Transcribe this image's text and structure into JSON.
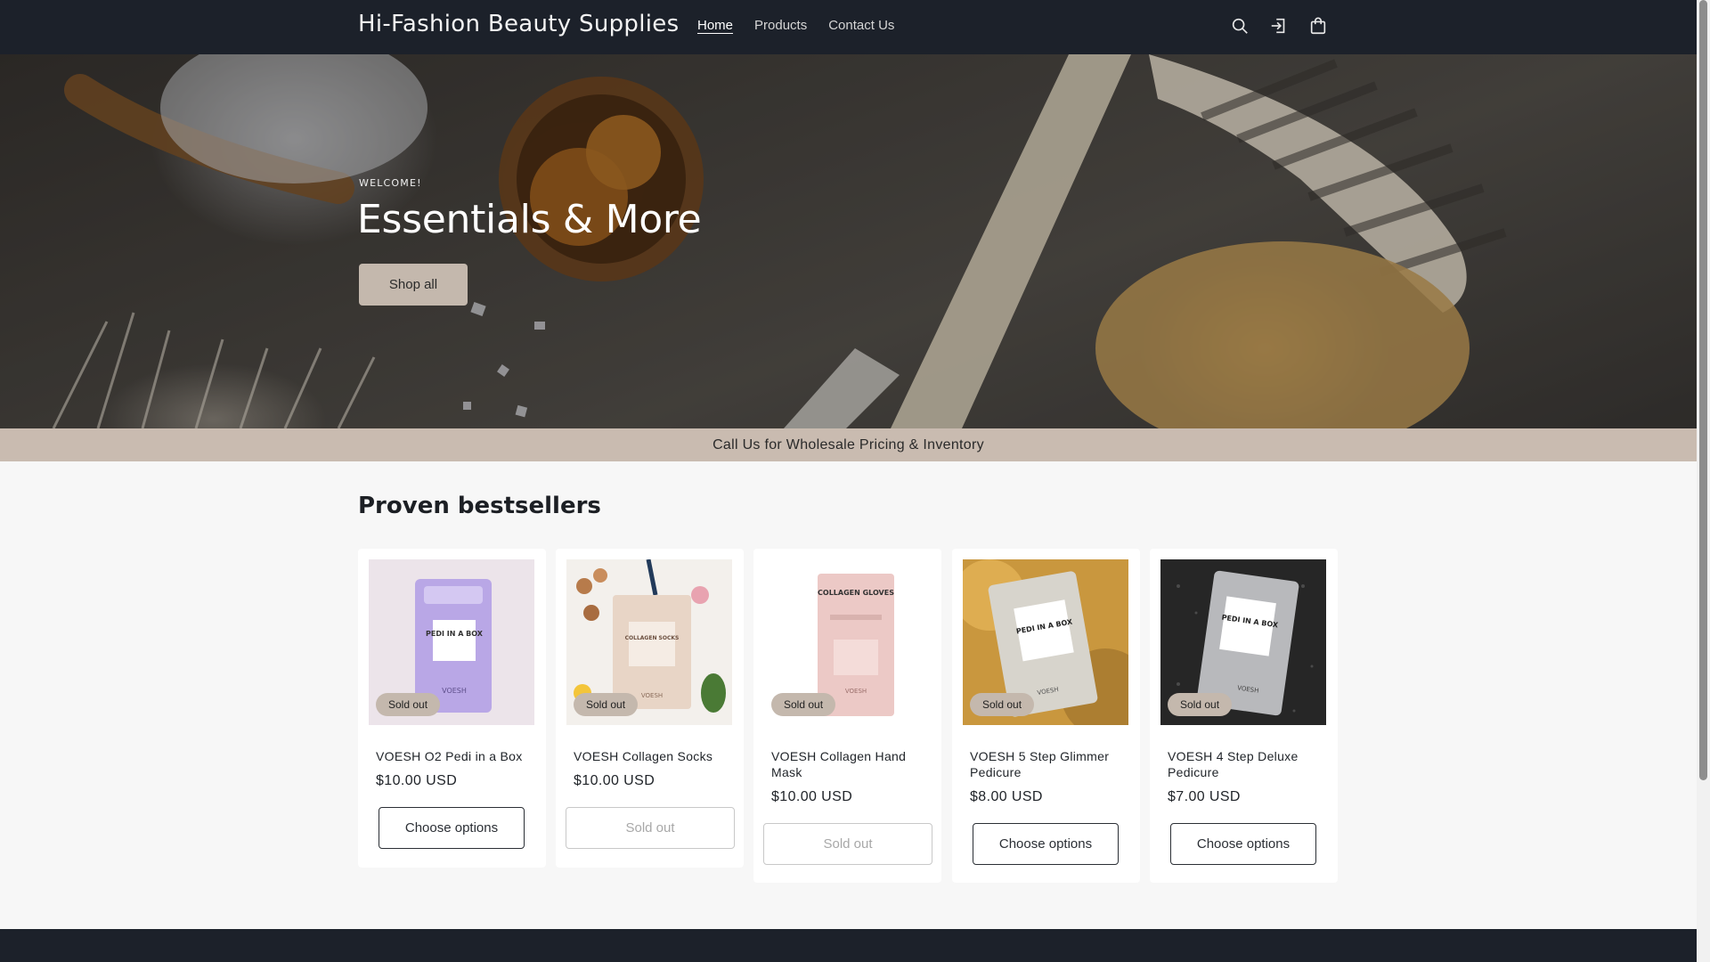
{
  "header": {
    "brand": "Hi-Fashion Beauty Supplies",
    "nav": [
      "Home",
      "Products",
      "Contact Us"
    ],
    "active_nav": "Home",
    "icons": [
      "search-icon",
      "account-icon",
      "cart-icon"
    ],
    "background": "#1c212a"
  },
  "hero": {
    "eyebrow": "WELCOME!",
    "title": "Essentials & More",
    "button": "Shop all"
  },
  "announcement": {
    "text": "Call Us for Wholesale Pricing & Inventory",
    "background": "#c9bbb0"
  },
  "bestsellers": {
    "title": "Proven bestsellers",
    "products": [
      {
        "name": "VOESH O2 Pedi in a Box",
        "price": "$10.00 USD",
        "badge": "Sold out",
        "button": "Choose options",
        "button_disabled": false,
        "package_text": "PEDI IN A BOX",
        "brand_text": "VOESH"
      },
      {
        "name": "VOESH Collagen Socks",
        "price": "$10.00 USD",
        "badge": "Sold out",
        "button": "Sold out",
        "button_disabled": true,
        "package_text": "COLLAGEN SOCKS",
        "brand_text": "VOESH"
      },
      {
        "name": "VOESH Collagen Hand Mask",
        "price": "$10.00 USD",
        "badge": "Sold out",
        "button": "Sold out",
        "button_disabled": true,
        "package_text": "COLLAGEN GLOVES",
        "brand_text": "VOESH"
      },
      {
        "name": "VOESH 5 Step Glimmer Pedicure",
        "price": "$8.00 USD",
        "badge": "Sold out",
        "button": "Choose options",
        "button_disabled": false,
        "package_text": "PEDI IN A BOX",
        "brand_text": "VOESH"
      },
      {
        "name": "VOESH 4 Step Deluxe Pedicure",
        "price": "$7.00 USD",
        "badge": "Sold out",
        "button": "Choose options",
        "button_disabled": false,
        "package_text": "PEDI IN A BOX",
        "brand_text": "VOESH"
      }
    ]
  }
}
